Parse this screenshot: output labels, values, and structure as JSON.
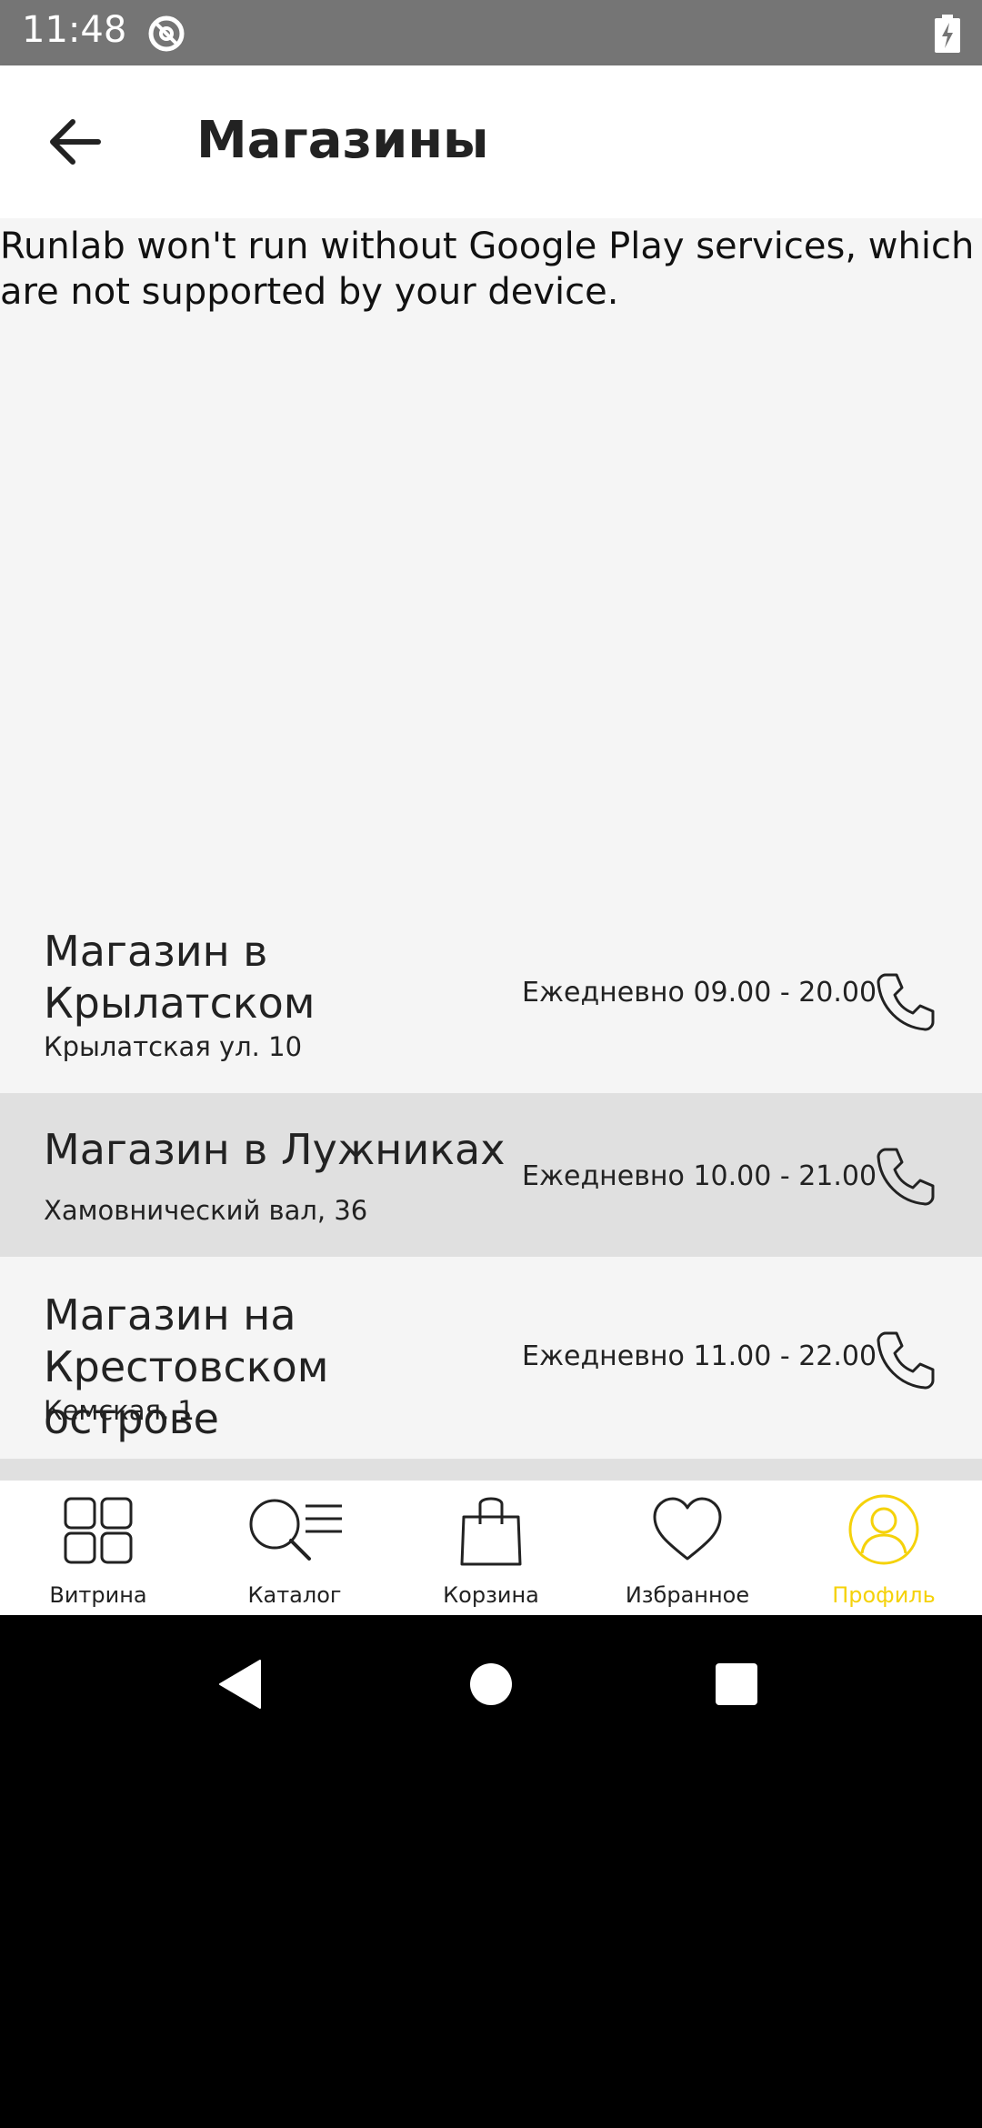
{
  "status_bar": {
    "time": "11:48",
    "sync_icon": "sync-icon",
    "battery_icon": "battery-charging-icon"
  },
  "app_bar": {
    "back_icon": "arrow-back-icon",
    "title": "Магазины"
  },
  "message": "Runlab won't run without Google Play services, which are not supported by your device.",
  "stores": [
    {
      "name": "Магазин в Крылатском",
      "address": "Крылатская ул. 10",
      "hours": "Ежедневно 09.00 - 20.00",
      "phone_icon": "phone-icon"
    },
    {
      "name": "Магазин в Лужниках",
      "address": "Хамовнический вал, 36",
      "hours": "Ежедневно 10.00 - 21.00",
      "phone_icon": "phone-icon"
    },
    {
      "name": "Магазин на Крестовском острове",
      "address": "Кемская, 1",
      "hours": "Ежедневно 11.00 - 22.00",
      "phone_icon": "phone-icon"
    }
  ],
  "bottom_nav": {
    "items": [
      {
        "label": "Витрина",
        "icon": "grid-icon"
      },
      {
        "label": "Каталог",
        "icon": "search-list-icon"
      },
      {
        "label": "Корзина",
        "icon": "shopping-bag-icon"
      },
      {
        "label": "Избранное",
        "icon": "heart-icon"
      },
      {
        "label": "Профиль",
        "icon": "profile-icon"
      }
    ],
    "active_index": 4,
    "active_color": "#f5d20a"
  },
  "system_nav": {
    "back": "system-back-icon",
    "home": "system-home-icon",
    "recents": "system-recents-icon"
  }
}
